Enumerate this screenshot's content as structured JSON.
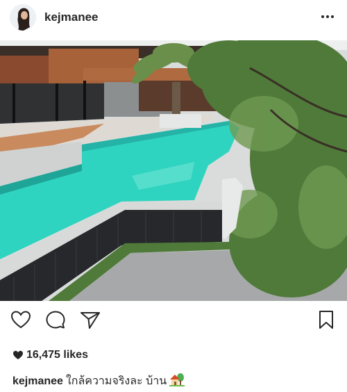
{
  "post": {
    "username": "kejmanee",
    "more_icon": "more-horizontal-icon",
    "likes_text": "16,475 likes",
    "caption_user": "kejmanee",
    "caption_text": "ใกล้ความจริงละ บ้าน",
    "caption_emoji": "house-with-garden-emoji"
  },
  "actions": {
    "like_icon": "heart-outline-icon",
    "comment_icon": "comment-bubble-icon",
    "share_icon": "send-paper-plane-icon",
    "save_icon": "bookmark-icon"
  },
  "colors": {
    "text": "#262626",
    "pool": "#2fd4c0",
    "stone_wall": "#2b2d30",
    "foliage": "#4f7a3a"
  }
}
